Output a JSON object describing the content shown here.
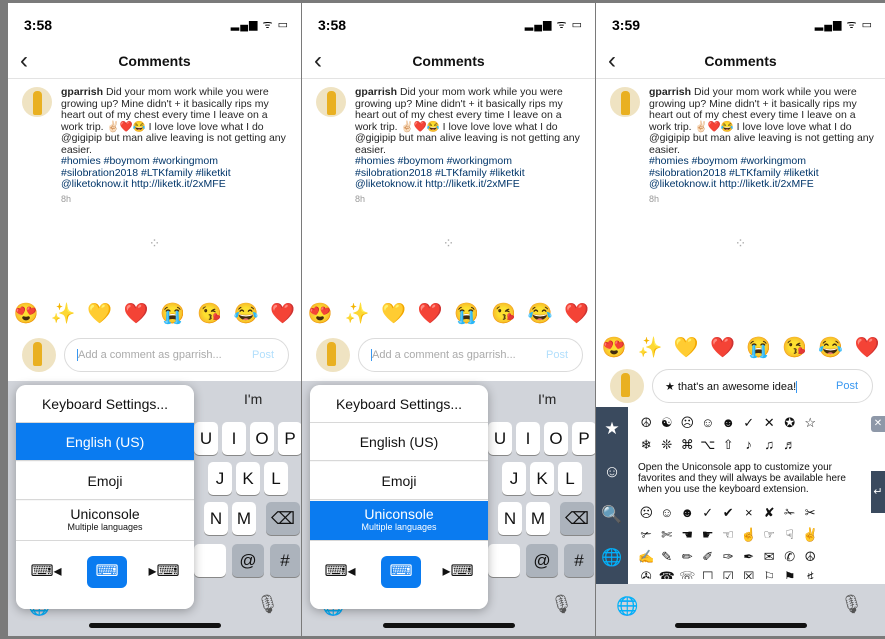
{
  "header": {
    "title": "Comments",
    "back_icon": "‹"
  },
  "statusbar": {
    "times": [
      "3:58",
      "3:58",
      "3:59"
    ],
    "signal_label": "▂▄▆ ᯤ ▭"
  },
  "comment": {
    "username": "gparrish",
    "text": "Did your mom work while you were growing up? Mine didn't + it basically rips my heart out of my chest every time I leave on a work trip. ✌🏻❤️😂 I love love love what I do @gigipip but man alive leaving is not getting any easier.",
    "tags": "#homies #boymom #workingmom #silobration2018 #LTKfamily #liketkit @liketoknow.it http://liketk.it/2xMFE",
    "ago": "8h"
  },
  "spinner": "⁘",
  "emoji_bar": [
    "😍",
    "✨",
    "💛",
    "❤️",
    "😭",
    "😘",
    "😂",
    "❤️"
  ],
  "input": {
    "placeholder": "Add a comment as gparrish...",
    "value_p3": "★ that's an awesome idea!",
    "post_label": "Post"
  },
  "keyboard": {
    "suggestion": "I'm",
    "row1": [
      "U",
      "I",
      "O",
      "P"
    ],
    "row2": [
      "J",
      "K",
      "L"
    ],
    "row3": [
      "N",
      "M"
    ],
    "delete_icon": "⌫",
    "at": "@",
    "hash": "#",
    "globe_icon": "🌐",
    "mic_icon": "🎙"
  },
  "menu": {
    "items": [
      "Keyboard Settings...",
      "English (US)",
      "Emoji",
      "Uniconsole"
    ],
    "uniconsole_sub": "Multiple languages",
    "icons": [
      "⌨◂",
      "⌨",
      "▸⌨"
    ]
  },
  "uniconsole": {
    "side_icons": [
      "★",
      "☺",
      "🔍",
      "🌐"
    ],
    "row1": [
      "☮",
      "☯",
      "☹",
      "☺",
      "☻",
      "✓",
      "✕",
      "✪",
      "☆"
    ],
    "row2": [
      "❄",
      "❊",
      "⌘",
      "⌥",
      "⇧",
      "♪",
      "♫",
      "♬"
    ],
    "message": "Open the Uniconsole app to customize your favorites and they will always be available here when you use the keyboard extension.",
    "row3": [
      "☹",
      "☺",
      "☻",
      "✓",
      "✔",
      "×",
      "✘",
      "✁",
      "✂"
    ],
    "row4": [
      "✃",
      "✄",
      "☚",
      "☛",
      "☜",
      "☝",
      "☞",
      "☟",
      "✌"
    ],
    "row5": [
      "✍",
      "✎",
      "✏",
      "✐",
      "✑",
      "✒",
      "✉",
      "✆",
      "☮"
    ],
    "row6": [
      "✇",
      "☎",
      "☏",
      "☐",
      "☑",
      "☒",
      "⚐",
      "⚑",
      "♯"
    ],
    "delete_icon": "✕",
    "return_icon": "↵"
  }
}
